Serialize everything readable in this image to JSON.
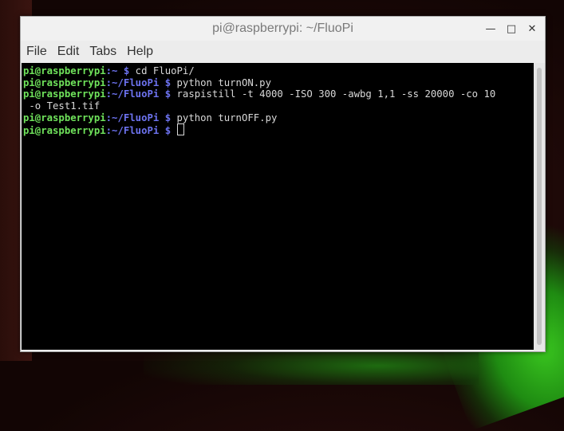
{
  "window": {
    "title": "pi@raspberrypi: ~/FluoPi",
    "controls": {
      "minimize": "—",
      "maximize": "□",
      "close": "✕"
    }
  },
  "menu": {
    "items": [
      "File",
      "Edit",
      "Tabs",
      "Help"
    ]
  },
  "terminal": {
    "lines": [
      {
        "user": "pi@raspberrypi",
        "path": ":~",
        "sym": " $",
        "cmd": " cd FluoPi/"
      },
      {
        "user": "pi@raspberrypi",
        "path": ":~/FluoPi",
        "sym": " $",
        "cmd": " python turnON.py"
      },
      {
        "user": "pi@raspberrypi",
        "path": ":~/FluoPi",
        "sym": " $",
        "cmd": " raspistill -t 4000 -ISO 300 -awbg 1,1 -ss 20000 -co 10"
      },
      {
        "user": "",
        "path": "",
        "sym": "",
        "cmd": " -o Test1.tif"
      },
      {
        "user": "pi@raspberrypi",
        "path": ":~/FluoPi",
        "sym": " $",
        "cmd": " python turnOFF.py"
      },
      {
        "user": "pi@raspberrypi",
        "path": ":~/FluoPi",
        "sym": " $",
        "cmd": " "
      }
    ]
  },
  "colors": {
    "user": "#6fe25b",
    "path": "#6d73f0",
    "text": "#d8d8d8",
    "background": "#000000"
  }
}
